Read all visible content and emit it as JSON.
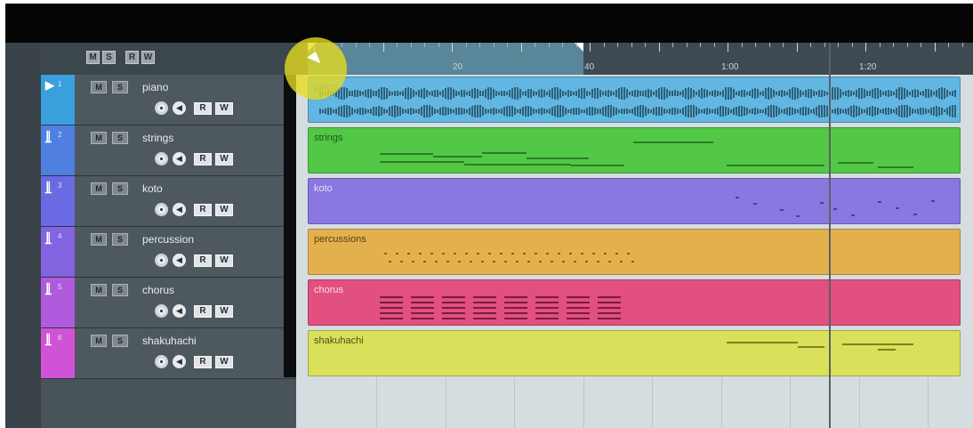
{
  "header_buttons": [
    {
      "id": "m",
      "label": "M"
    },
    {
      "id": "s",
      "label": "S"
    },
    {
      "id": "r",
      "label": "R"
    },
    {
      "id": "w",
      "label": "W"
    }
  ],
  "ruler": {
    "labels": [
      "20",
      "40",
      "1:00",
      "1:20"
    ]
  },
  "tracks": [
    {
      "number": "1",
      "name": "piano",
      "clip_label": "piano",
      "type": "audio",
      "icon": "play-icon",
      "color": "#3aa0dd",
      "clip_color": "#62b6e2",
      "clip_text_color": "#3e6b80"
    },
    {
      "number": "2",
      "name": "strings",
      "clip_label": "strings",
      "type": "instrument",
      "icon": "instrument-icon",
      "color": "#4f7fe0",
      "clip_color": "#52c846",
      "clip_text_color": "#1f5a18"
    },
    {
      "number": "3",
      "name": "koto",
      "clip_label": "koto",
      "type": "instrument",
      "icon": "instrument-icon",
      "color": "#6a6ae2",
      "clip_color": "#8a78e0",
      "clip_text_color": "#e4def8"
    },
    {
      "number": "4",
      "name": "percussion",
      "clip_label": "percussions",
      "type": "instrument",
      "icon": "instrument-icon",
      "color": "#8264e0",
      "clip_color": "#e3b04e",
      "clip_text_color": "#5a3f0c"
    },
    {
      "number": "5",
      "name": "chorus",
      "clip_label": "chorus",
      "type": "instrument",
      "icon": "instrument-icon",
      "color": "#b05ade",
      "clip_color": "#e2507f",
      "clip_text_color": "#fbdbe6"
    },
    {
      "number": "6",
      "name": "shakuhachi",
      "clip_label": "shakuhachi",
      "type": "instrument",
      "icon": "instrument-icon",
      "color": "#d052d6",
      "clip_color": "#d9e05a",
      "clip_text_color": "#4d5110"
    }
  ],
  "track_buttons": {
    "mute": "M",
    "solo": "S",
    "record": "R",
    "monitor": "W"
  },
  "colors": {
    "loop_range": "#5a8699",
    "playhead": "#5a6166",
    "cursor_highlight": "#e8dc1e"
  }
}
